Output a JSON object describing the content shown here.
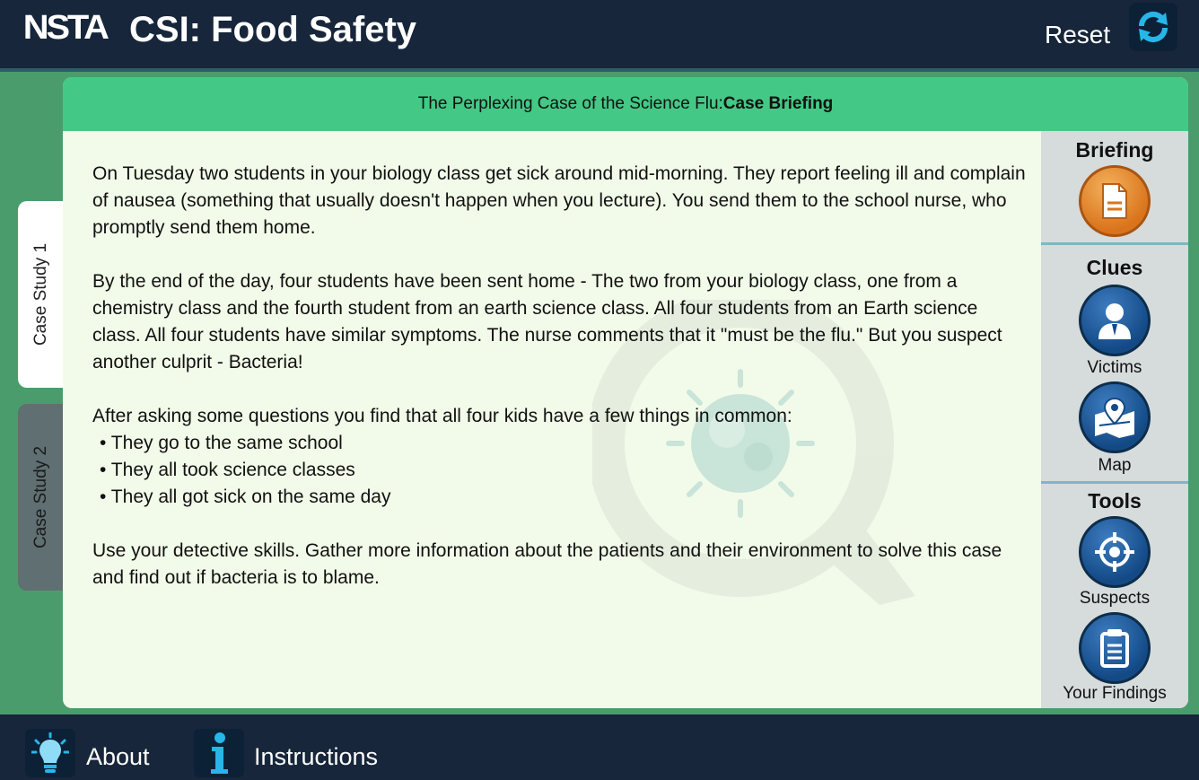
{
  "header": {
    "logo_text": "NSTA",
    "app_title": "CSI: Food Safety",
    "reset_label": "Reset"
  },
  "tabs": [
    {
      "label": "Case Study 1",
      "active": true
    },
    {
      "label": "Case Study 2",
      "active": false
    }
  ],
  "panel": {
    "header_prefix": "The Perplexing Case of the Science Flu:",
    "header_section": "Case Briefing",
    "paragraphs": [
      "On Tuesday two students in your biology class get sick around mid-morning. They report feeling ill and complain of nausea (something that usually doesn't happen when you lecture). You send them to the school nurse, who promptly send them home.",
      "By the end of the day, four students have been sent home - The two from your biology class, one from a chemistry class and the fourth student from an earth science class. All four students from an Earth science class. All four students have similar symptoms. The nurse comments that it \"must be the flu.\" But you suspect another culprit - Bacteria!",
      "After asking some questions you find that all four kids have a few things in common:"
    ],
    "bullets": [
      "• They go to the same school",
      "• They all took science classes",
      "• They all got sick on the same day"
    ],
    "closing": "Use your detective skills. Gather more information about the patients and their environment to solve this case and find out if bacteria is to blame."
  },
  "sidebar": {
    "briefing_title": "Briefing",
    "clues_title": "Clues",
    "tools_title": "Tools",
    "victims_label": "Victims",
    "map_label": "Map",
    "suspects_label": "Suspects",
    "findings_label": "Your Findings"
  },
  "footer": {
    "about_label": "About",
    "instructions_label": "Instructions"
  },
  "colors": {
    "top_bar": "#17263a",
    "stage_green": "#4a9c6d",
    "header_green": "#44c885",
    "panel_bg": "#f2fbe9",
    "briefing_orange": "#e08a2c",
    "button_blue": "#134a86",
    "accent_cyan": "#27b6e8"
  }
}
